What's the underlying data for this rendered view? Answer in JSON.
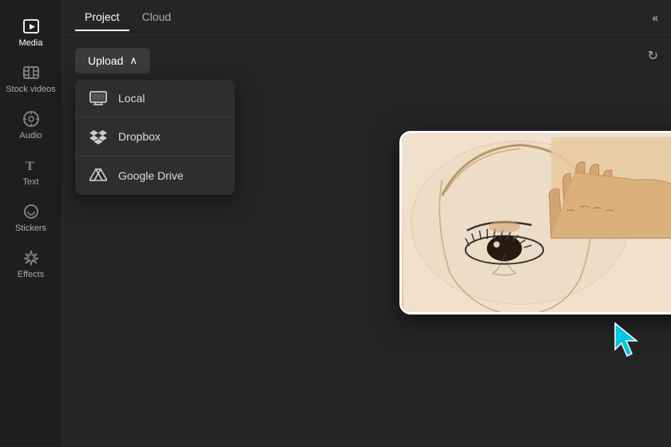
{
  "sidebar": {
    "items": [
      {
        "id": "media",
        "label": "Media",
        "icon": "▶",
        "active": true
      },
      {
        "id": "stock-videos",
        "label": "Stock videos",
        "icon": "⊞",
        "active": false
      },
      {
        "id": "audio",
        "label": "Audio",
        "icon": "♫",
        "active": false
      },
      {
        "id": "text",
        "label": "Text",
        "icon": "T",
        "active": false
      },
      {
        "id": "stickers",
        "label": "Stickers",
        "icon": "◎",
        "active": false
      },
      {
        "id": "effects",
        "label": "Effects",
        "icon": "✦",
        "active": false
      }
    ]
  },
  "tabs": {
    "items": [
      {
        "id": "project",
        "label": "Project",
        "active": true
      },
      {
        "id": "cloud",
        "label": "Cloud",
        "active": false
      }
    ],
    "collapse_label": "«"
  },
  "upload": {
    "label": "Upload",
    "chevron": "∧"
  },
  "refresh": {
    "icon": "↻"
  },
  "dropdown": {
    "items": [
      {
        "id": "local",
        "label": "Local",
        "icon": "local"
      },
      {
        "id": "dropbox",
        "label": "Dropbox",
        "icon": "dropbox"
      },
      {
        "id": "google-drive",
        "label": "Google Drive",
        "icon": "drive"
      }
    ]
  },
  "preview": {
    "alt": "Sketch drawing of an eye with hand"
  },
  "cursor": {
    "color": "#00c8e0"
  },
  "colors": {
    "accent": "#00c8e0",
    "sidebar_bg": "#1e1e1e",
    "main_bg": "#252525",
    "dropdown_bg": "#2e2e2e",
    "active_tab_color": "#ffffff"
  }
}
